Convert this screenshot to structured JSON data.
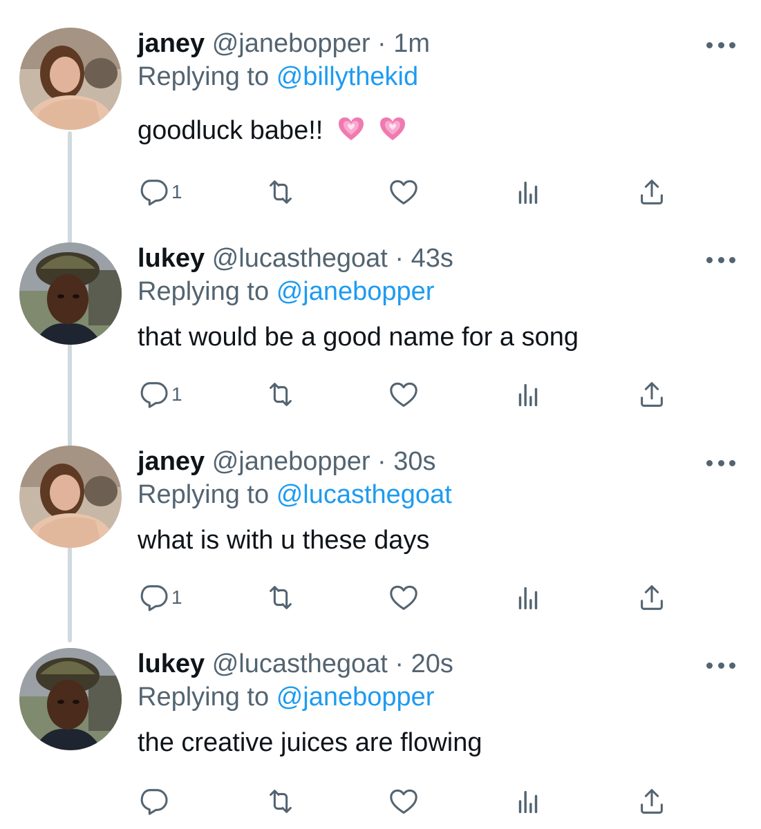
{
  "tweets": [
    {
      "name": "janey",
      "handle": "@janebopper",
      "dot": "·",
      "time": "1m",
      "replying_prefix": "Replying to",
      "replying_to": "@billythekid",
      "text": "goodluck babe!!",
      "emoji": [
        "growing-heart",
        "growing-heart"
      ],
      "reply_count": "1",
      "avatar": "janey-avatar"
    },
    {
      "name": "lukey",
      "handle": "@lucasthegoat",
      "dot": "·",
      "time": "43s",
      "replying_prefix": "Replying to",
      "replying_to": "@janebopper",
      "text": "that would be a good name for a song",
      "reply_count": "1",
      "avatar": "lukey-avatar"
    },
    {
      "name": "janey",
      "handle": "@janebopper",
      "dot": "·",
      "time": "30s",
      "replying_prefix": "Replying to",
      "replying_to": "@lucasthegoat",
      "text": "what is with u these days",
      "reply_count": "1",
      "avatar": "janey-avatar"
    },
    {
      "name": "lukey",
      "handle": "@lucasthegoat",
      "dot": "·",
      "time": "20s",
      "replying_prefix": "Replying to",
      "replying_to": "@janebopper",
      "text": "the creative juices are flowing",
      "reply_count": "",
      "avatar": "lukey-avatar"
    }
  ],
  "colors": {
    "link": "#1d9bf0",
    "muted": "#536471",
    "text": "#0f1419",
    "thread_line": "#cfd9de"
  },
  "icons": [
    "reply-icon",
    "retweet-icon",
    "like-icon",
    "views-icon",
    "share-icon",
    "more-icon"
  ]
}
